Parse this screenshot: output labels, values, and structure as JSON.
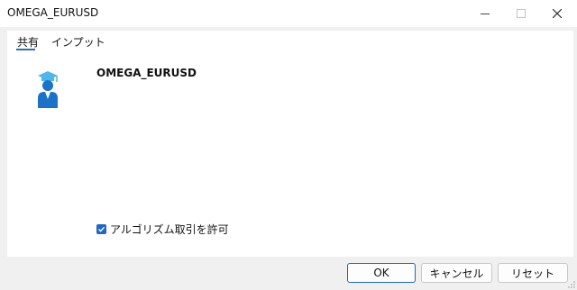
{
  "window": {
    "title": "OMEGA_EURUSD"
  },
  "tabs": [
    {
      "label": "共有",
      "active": true
    },
    {
      "label": "インプット",
      "active": false
    }
  ],
  "expert": {
    "name": "OMEGA_EURUSD",
    "icon": "expert-advisor-graduate-icon"
  },
  "options": {
    "allow_algo_label": "アルゴリズム取引を許可",
    "allow_algo_checked": true
  },
  "buttons": {
    "ok": "OK",
    "cancel": "キャンセル",
    "reset": "リセット"
  },
  "colors": {
    "accent": "#1e66c7",
    "icon_blue": "#1a73c9",
    "icon_cap": "#4cb8e8"
  }
}
